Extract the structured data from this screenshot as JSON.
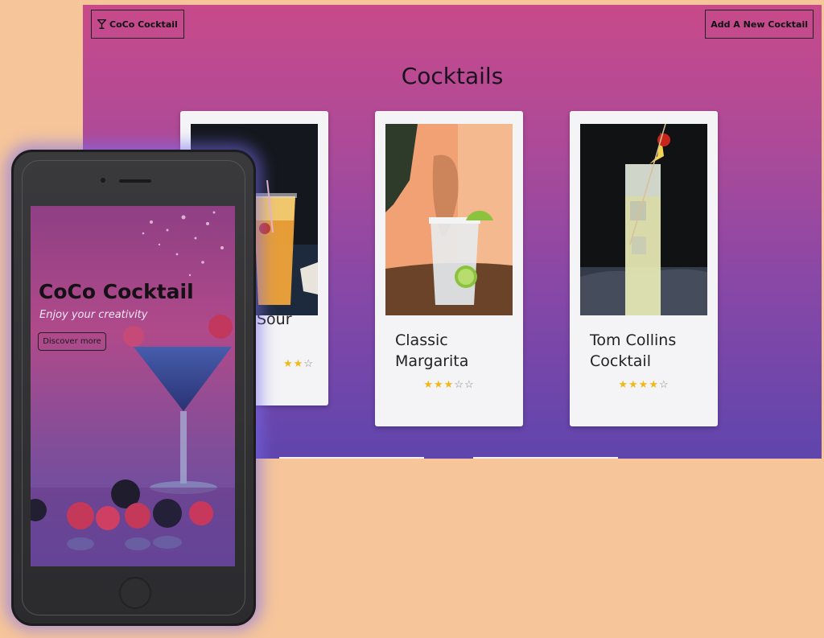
{
  "desktop": {
    "brand_label": "CoCo Cocktail",
    "add_label": "Add A New Cocktail",
    "title": "Cocktails",
    "cards": [
      {
        "name_line1": "",
        "name_line2": "Sour",
        "stars": "★★★☆☆",
        "rating": 3
      },
      {
        "name_line1": "Classic",
        "name_line2": "Margarita",
        "stars": "★★★☆☆",
        "rating": 3
      },
      {
        "name_line1": "Tom Collins",
        "name_line2": "Cocktail",
        "stars": "★★★★☆",
        "rating": 4
      }
    ]
  },
  "mobile": {
    "hero_title": "CoCo Cocktail",
    "hero_subtitle": "Enjoy your creativity",
    "discover_label": "Discover more"
  },
  "colors": {
    "background": "#f6c59a",
    "gradient_top": "#c84a8a",
    "gradient_bottom": "#5f45ad",
    "star": "#f0b81a"
  }
}
